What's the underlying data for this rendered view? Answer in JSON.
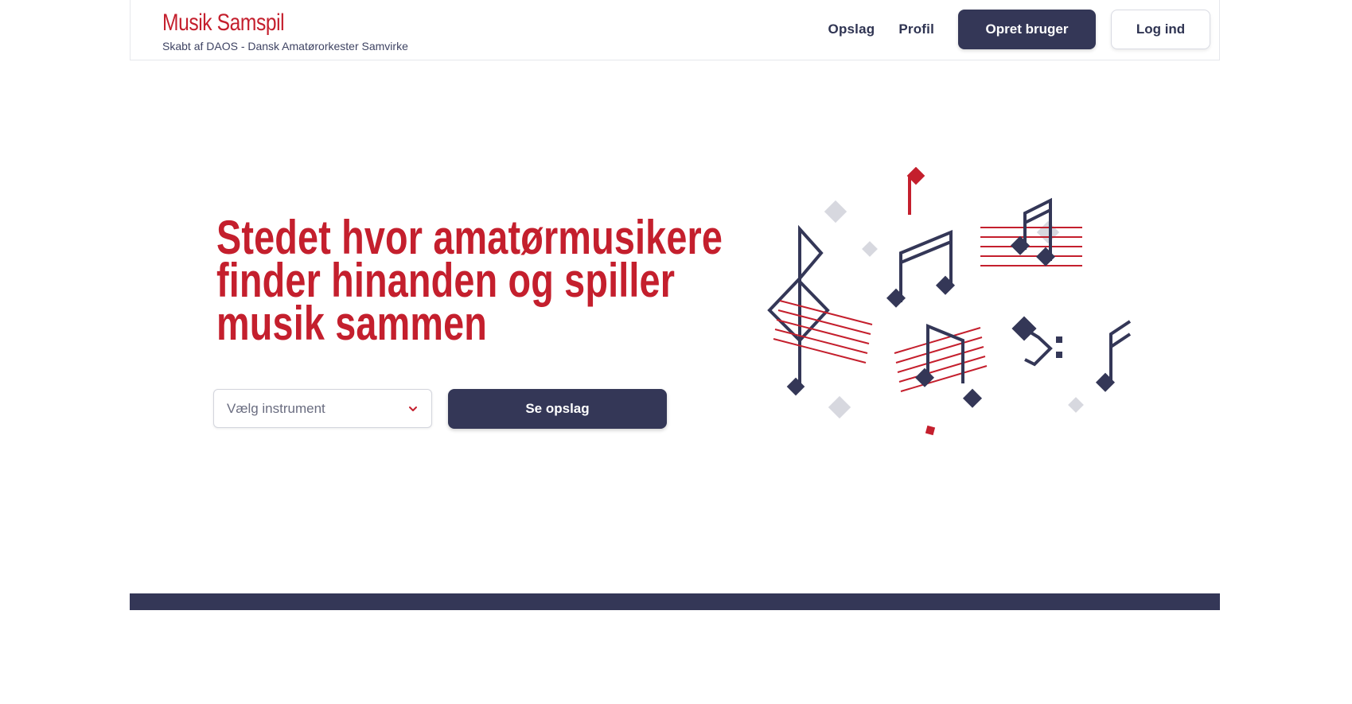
{
  "header": {
    "title": "Musik Samspil",
    "subtitle": "Skabt af DAOS - Dansk Amatørorkester Samvirke",
    "nav": {
      "opslag": "Opslag",
      "profil": "Profil",
      "signup": "Opret bruger",
      "login": "Log ind"
    }
  },
  "hero": {
    "headline_lines": [
      "Stedet hvor amatørmusikere",
      "finder hinanden og spiller",
      "musik sammen"
    ],
    "instrument_select": {
      "placeholder": "Vælg instrument"
    },
    "search_button": "Se opslag"
  },
  "colors": {
    "brand_red": "#c41f2d",
    "navy": "#343757",
    "light_grey": "#d9dbe3"
  },
  "icons": [
    "chevron-down-icon",
    "music-notes-illustration"
  ]
}
